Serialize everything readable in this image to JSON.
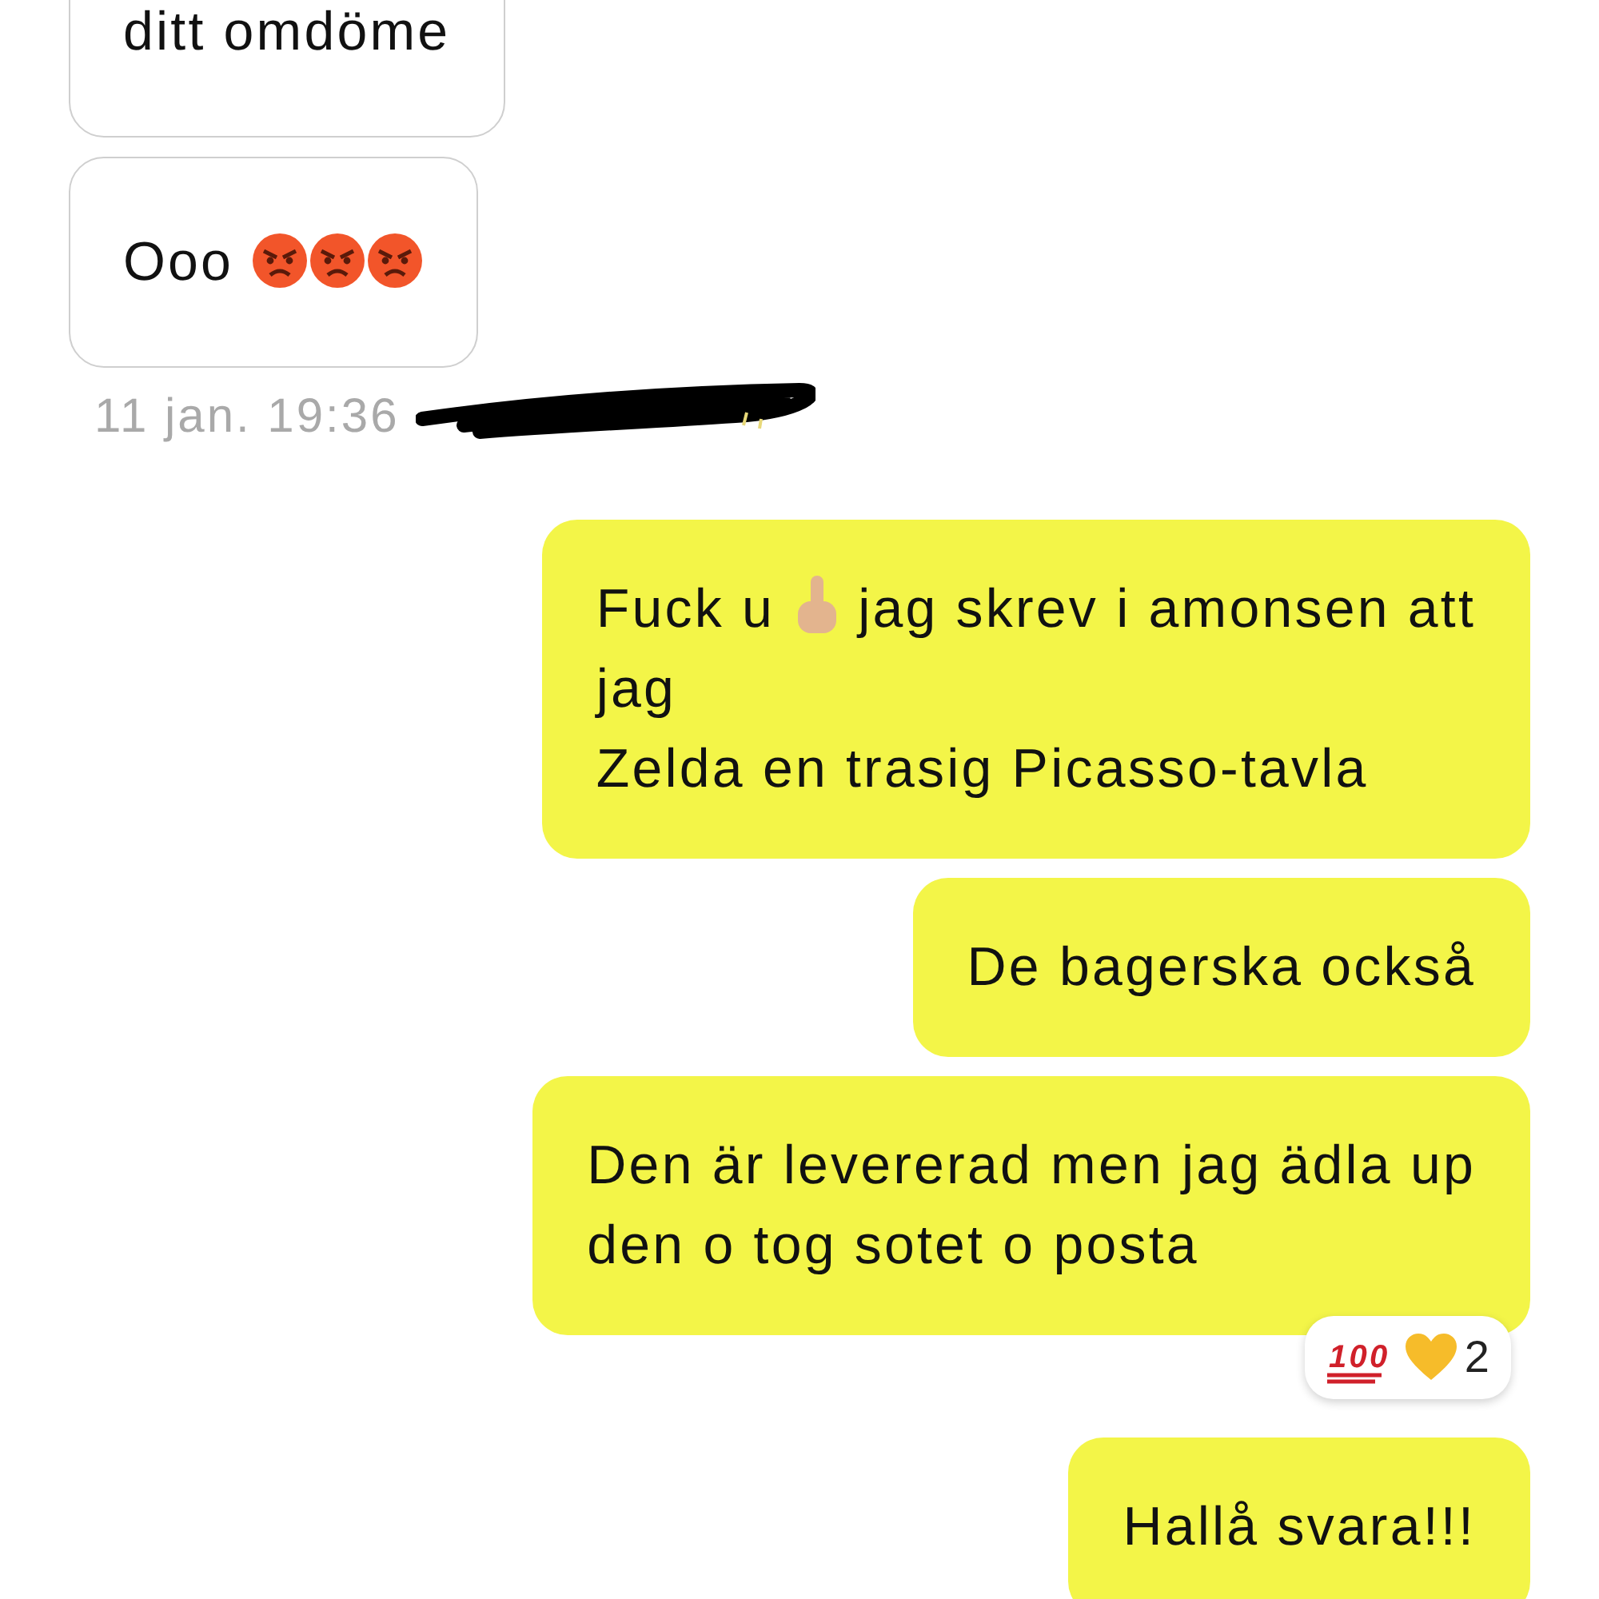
{
  "messages": [
    {
      "kind": "received",
      "parts": [
        {
          "kind": "text",
          "text": "ditt omdöme"
        }
      ]
    },
    {
      "kind": "received",
      "parts": [
        {
          "kind": "text",
          "text": "Ooo"
        },
        {
          "kind": "angry-face"
        },
        {
          "kind": "angry-face"
        },
        {
          "kind": "angry-face"
        }
      ]
    },
    {
      "kind": "timestamp",
      "parts": [
        {
          "kind": "text",
          "text": "11 jan. 19:36"
        },
        {
          "kind": "scribble"
        }
      ]
    },
    {
      "kind": "sent",
      "parts": [
        {
          "kind": "text",
          "text": "Fuck u"
        },
        {
          "kind": "hand"
        },
        {
          "kind": "text",
          "text": "jag skrev i amonsen att"
        },
        {
          "kind": "text-block",
          "text": "jag\nZelda en trasig Picasso-tavla"
        }
      ]
    },
    {
      "kind": "sent",
      "parts": [
        {
          "kind": "text",
          "text": "De bagerska också"
        }
      ]
    },
    {
      "kind": "sent",
      "parts": [
        {
          "kind": "text",
          "text": "Den är levererad men jag ädla up\nden o tog sotet o posta"
        }
      ],
      "reaction": {
        "hundred_label": "100",
        "count": "2"
      }
    },
    {
      "kind": "sent",
      "parts": [
        {
          "kind": "text",
          "text": "Hallå svara!!!"
        }
      ]
    }
  ]
}
